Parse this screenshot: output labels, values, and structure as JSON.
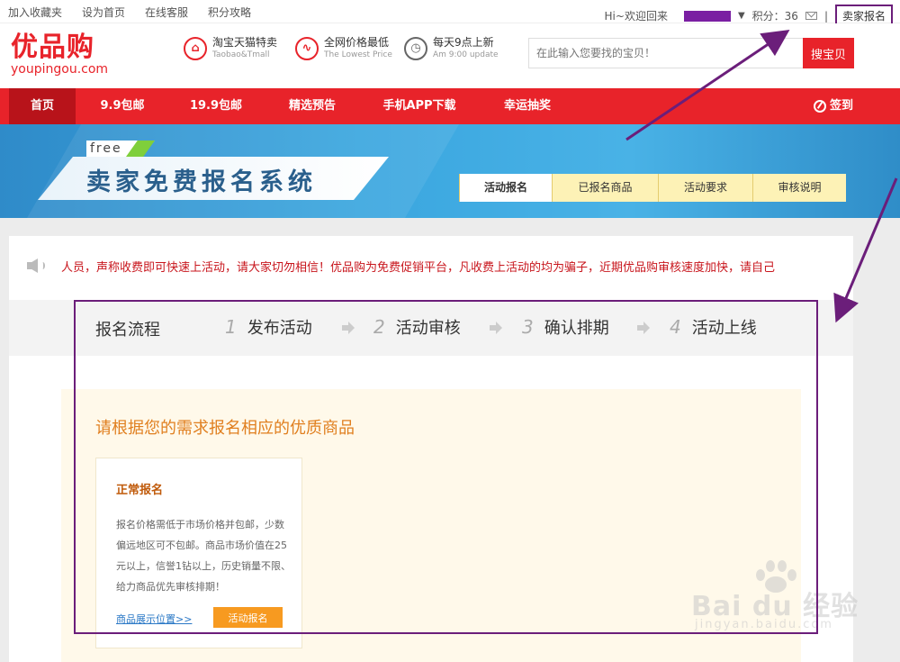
{
  "topbar": {
    "links_left": [
      "加入收藏夹",
      "设为首页",
      "在线客服",
      "积分攻略"
    ],
    "greeting": "Hi~欢迎回来",
    "points": "积分：36",
    "seller_signup": "卖家报名"
  },
  "header": {
    "logo_cn": "优品购",
    "logo_en": "youpingou.com",
    "features": [
      {
        "icon": "tag-icon",
        "title": "淘宝天猫特卖",
        "subtitle": "Taobao&Tmall"
      },
      {
        "icon": "price-down-icon",
        "title": "全网价格最低",
        "subtitle": "The Lowest Price"
      },
      {
        "icon": "clock-icon",
        "title": "每天9点上新",
        "subtitle": "Am 9:00 update"
      }
    ],
    "search_placeholder": "在此输入您要找的宝贝！",
    "search_button": "搜宝贝"
  },
  "nav": {
    "items": [
      "首页",
      "9.9包邮",
      "19.9包邮",
      "精选预告",
      "手机APP下载",
      "幸运抽奖"
    ],
    "active_index": 0,
    "signin": "签到"
  },
  "banner": {
    "free_tag": "free",
    "title": "卖家免费报名系统",
    "tabs": [
      "活动报名",
      "已报名商品",
      "活动要求",
      "审核说明"
    ],
    "active_tab": 0
  },
  "notice": {
    "text": "人员，声称收费即可快速上活动，请大家切勿相信！优品购为免费促销平台，凡收费上活动的均为骗子，近期优品购审核速度加快，请自己"
  },
  "process": {
    "title": "报名流程",
    "steps": [
      {
        "num": "1",
        "label": "发布活动"
      },
      {
        "num": "2",
        "label": "活动审核"
      },
      {
        "num": "3",
        "label": "确认排期"
      },
      {
        "num": "4",
        "label": "活动上线"
      }
    ]
  },
  "signup_section": {
    "heading": "请根据您的需求报名相应的优质商品",
    "card": {
      "title": "正常报名",
      "description": "报名价格需低于市场价格并包邮，少数偏远地区可不包邮。商品市场价值在25元以上，信誉1钻以上，历史销量不限、给力商品优先审核排期！",
      "link": "商品展示位置>>",
      "button": "活动报名"
    }
  },
  "watermark": {
    "text": "Bai du 经验",
    "url": "jingyan.baidu.com"
  },
  "colors": {
    "brand_red": "#e8232a",
    "annotation_purple": "#6b1e7a",
    "banner_blue": "#3aa6df",
    "tab_yellow": "#fdf2b6",
    "cta_orange": "#f79a20"
  }
}
